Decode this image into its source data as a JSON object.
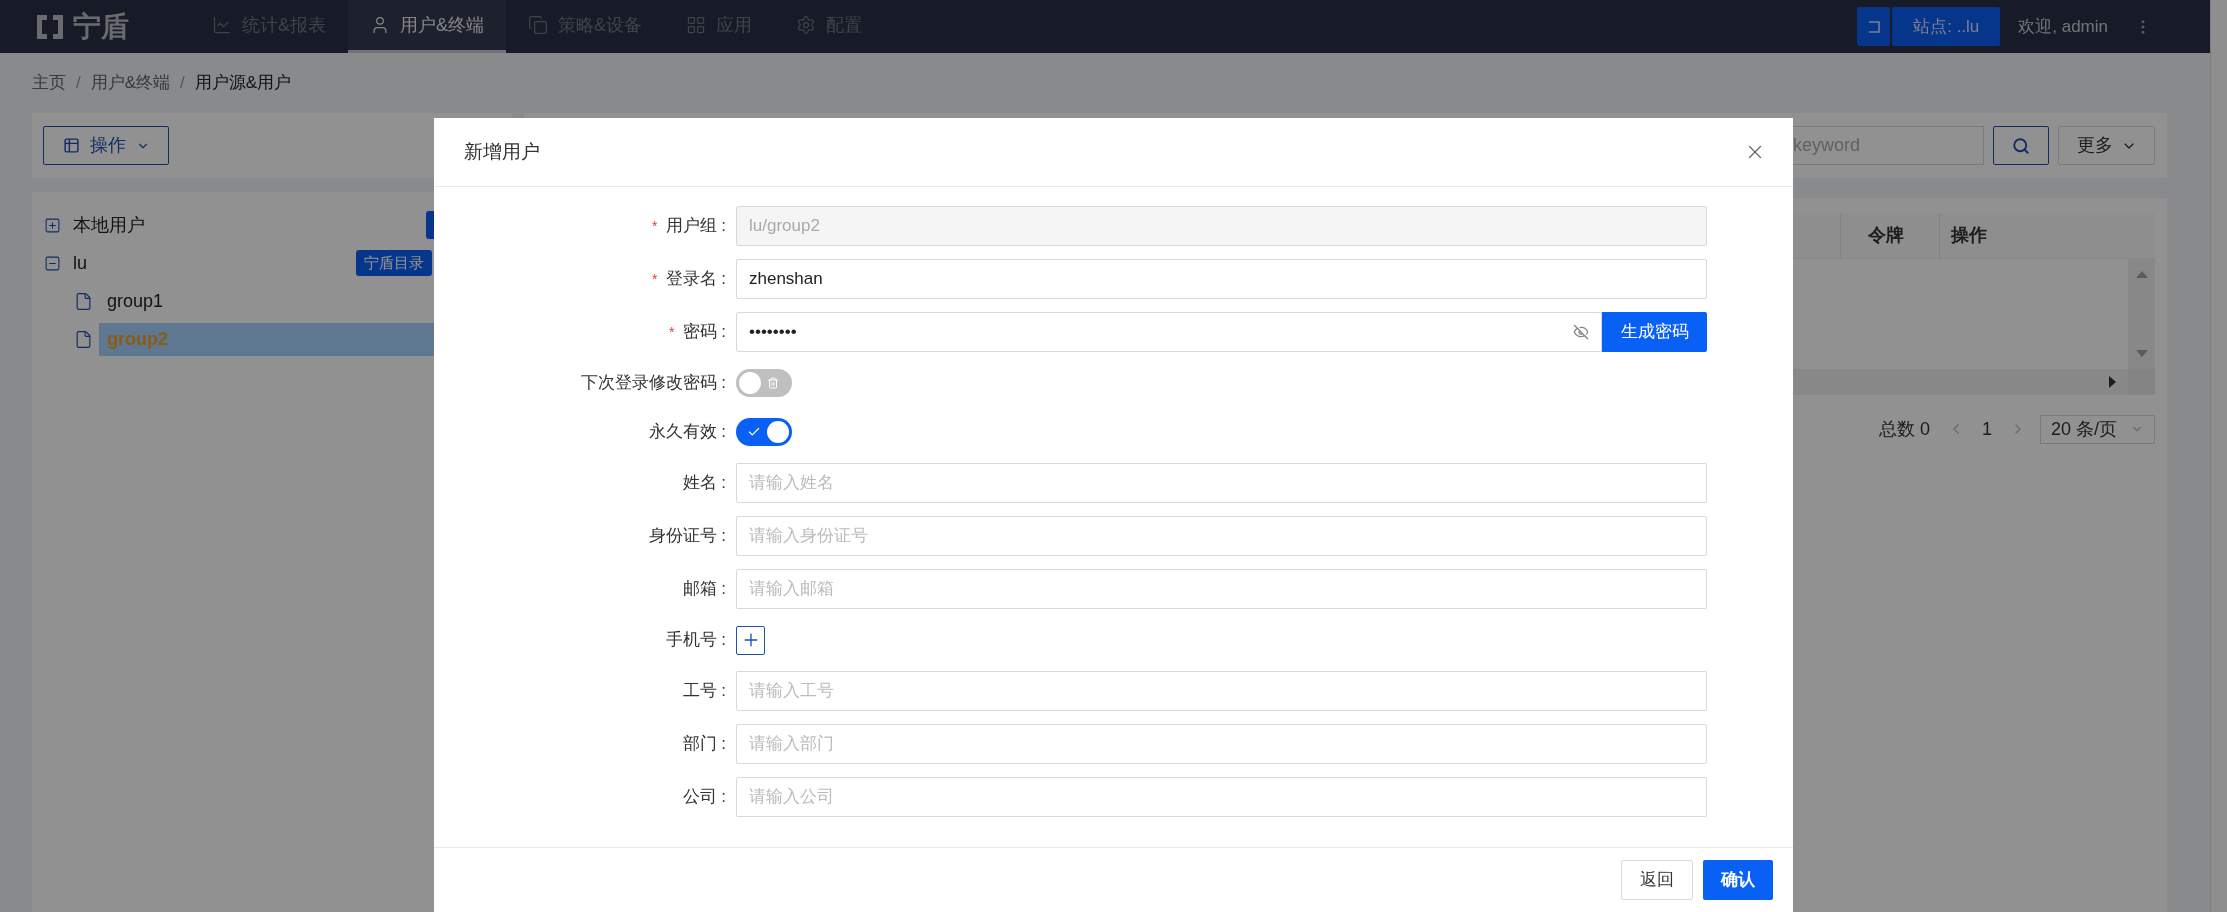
{
  "top_nav": {
    "logo": "宁盾",
    "items": [
      {
        "kind": "chart",
        "label": "统计&报表",
        "selected": false
      },
      {
        "kind": "user",
        "label": "用户&终端",
        "selected": true
      },
      {
        "kind": "device",
        "label": "策略&设备",
        "selected": false
      },
      {
        "kind": "apps",
        "label": "应用",
        "selected": false
      },
      {
        "kind": "settings",
        "label": "配置",
        "selected": false
      }
    ],
    "site_button": "站点: ..lu",
    "welcome": "欢迎, admin"
  },
  "breadcrumb": {
    "items": [
      "主页",
      "用户&终端",
      "用户源&用户"
    ],
    "separators": [
      "/",
      "/"
    ]
  },
  "left_panel": {
    "action_button": "操作",
    "tree": [
      {
        "label": "本地用户",
        "expanded": false
      },
      {
        "label": "lu",
        "expanded": true,
        "badge": "宁盾目录",
        "children": [
          {
            "label": "group1",
            "selected": false
          },
          {
            "label": "group2",
            "selected": true
          }
        ]
      }
    ]
  },
  "right_panel": {
    "search": {
      "placeholder": "keyword"
    },
    "more_button": "更多",
    "table": {
      "columns": [
        "令牌",
        "操作"
      ]
    },
    "pagination": {
      "total": "总数 0",
      "page": "1",
      "page_size": "20 条/页"
    }
  },
  "modal": {
    "title": "新增用户",
    "fields": [
      {
        "kind": "input",
        "label": "用户组 :",
        "required_mark": "*",
        "disabled": true,
        "value": "lu/group2"
      },
      {
        "kind": "input",
        "label": "登录名 :",
        "required_mark": "*",
        "disabled": false,
        "value": "zhenshan"
      },
      {
        "kind": "password",
        "label": "密码 :",
        "required_mark": "*",
        "value": "••••••••",
        "button": "生成密码"
      },
      {
        "kind": "toggle",
        "label": "下次登录修改密码 :",
        "on": false
      },
      {
        "kind": "toggle",
        "label": "永久有效 :",
        "on": true
      },
      {
        "kind": "input",
        "label": "姓名 :",
        "placeholder": "请输入姓名"
      },
      {
        "kind": "input",
        "label": "身份证号 :",
        "placeholder": "请输入身份证号"
      },
      {
        "kind": "input",
        "label": "邮箱 :",
        "placeholder": "请输入邮箱"
      },
      {
        "kind": "add",
        "label": "手机号 :"
      },
      {
        "kind": "input",
        "label": "工号 :",
        "placeholder": "请输入工号"
      },
      {
        "kind": "input",
        "label": "部门 :",
        "placeholder": "请输入部门"
      },
      {
        "kind": "input",
        "label": "公司 :",
        "placeholder": "请输入公司"
      }
    ],
    "buttons": [
      {
        "label": "返回",
        "primary": false
      },
      {
        "label": "确认",
        "primary": true
      }
    ]
  }
}
